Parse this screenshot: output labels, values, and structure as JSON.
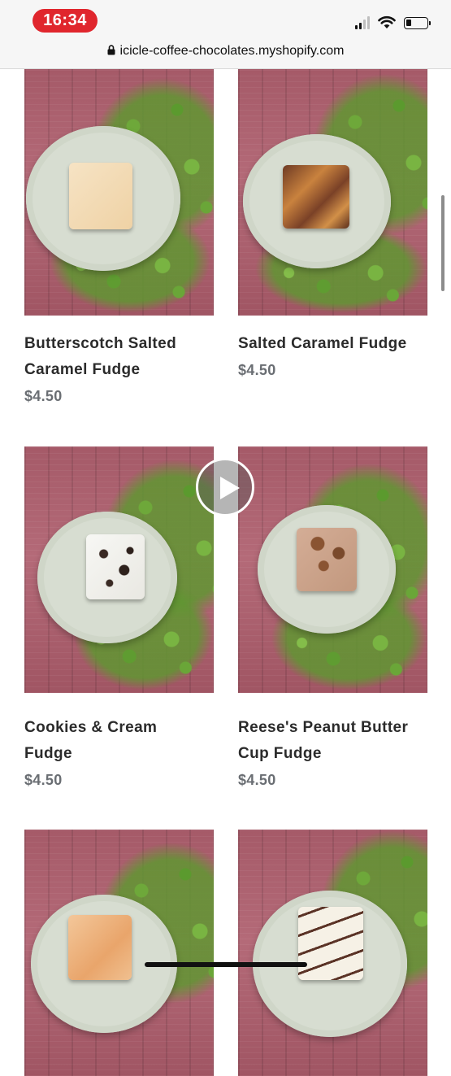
{
  "status_bar": {
    "time": "16:34"
  },
  "browser": {
    "url": "icicle-coffee-chocolates.myshopify.com"
  },
  "products": [
    {
      "name_line1": "Butterscotch Salted",
      "name_line2": "Caramel Fudge",
      "price": "$4.50"
    },
    {
      "name_line1": "Salted Caramel Fudge",
      "name_line2": "",
      "price": "$4.50"
    },
    {
      "name_line1": "Cookies & Cream",
      "name_line2": "Fudge",
      "price": "$4.50"
    },
    {
      "name_line1": "Reese's Peanut Butter",
      "name_line2": "Cup Fudge",
      "price": "$4.50"
    },
    {
      "name_line1": "",
      "name_line2": "",
      "price": ""
    },
    {
      "name_line1": "",
      "name_line2": "",
      "price": ""
    }
  ],
  "icons": {
    "lock": "lock-icon",
    "play": "play-icon",
    "wifi": "wifi-icon",
    "battery": "battery-icon",
    "signal": "signal-icon"
  },
  "colors": {
    "time_pill": "#e0262d",
    "product_name": "#2b2b2b",
    "price": "#6a6e73"
  }
}
